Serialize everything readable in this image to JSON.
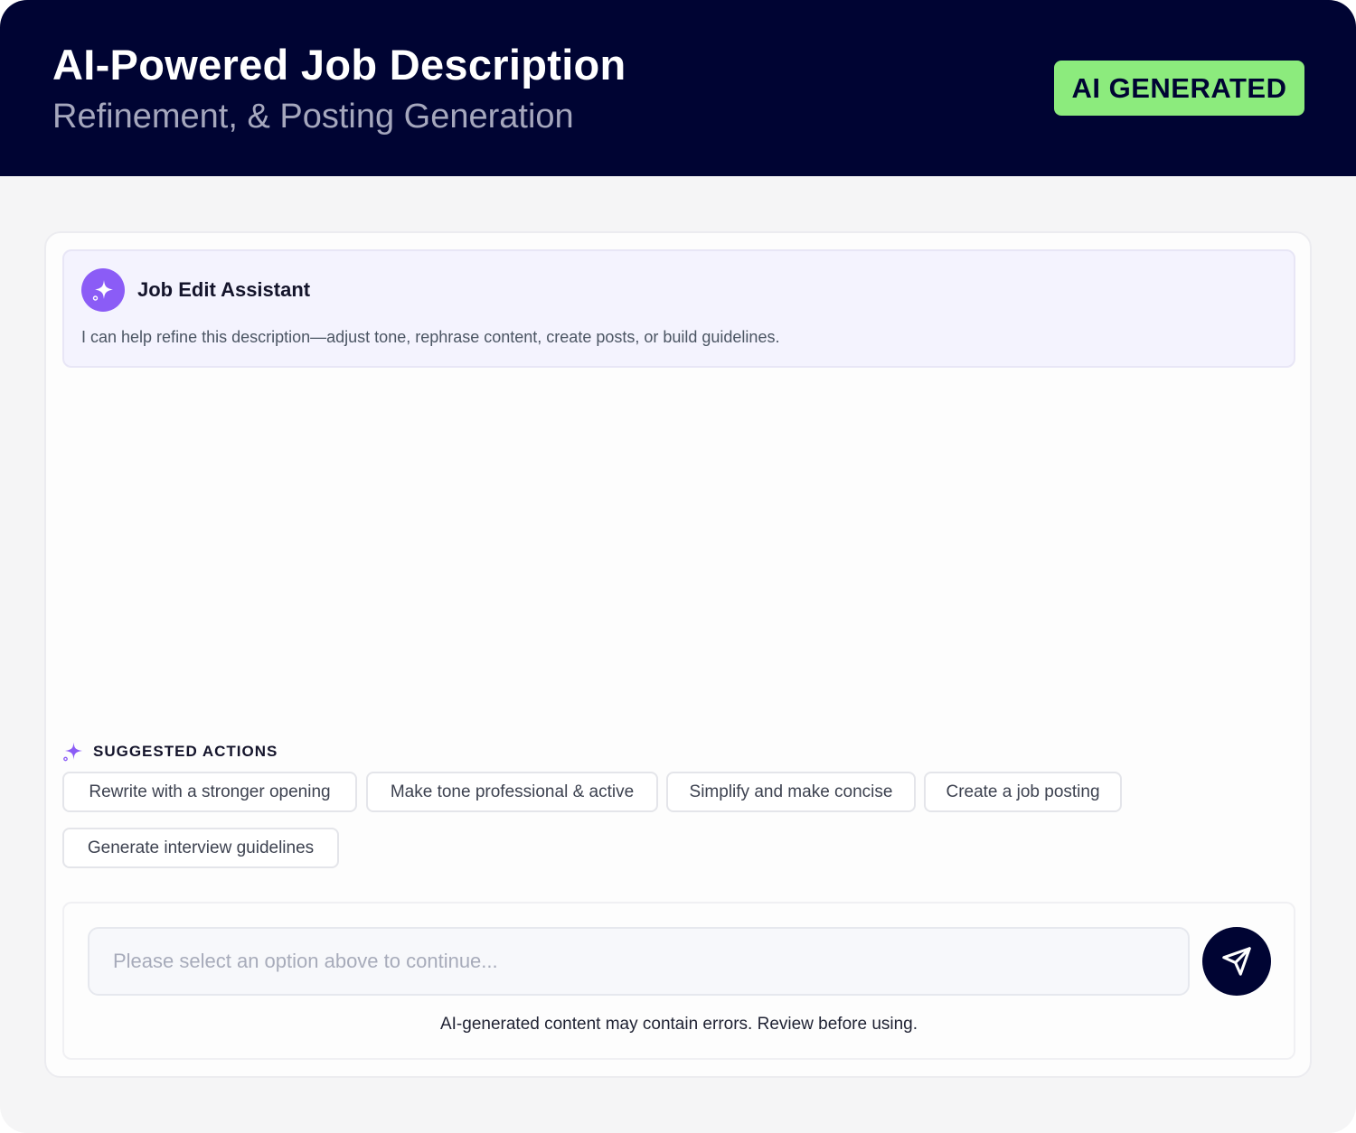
{
  "header": {
    "title": "AI-Powered Job Description",
    "subtitle": "Refinement, & Posting Generation",
    "badge": "AI GENERATED"
  },
  "assistant": {
    "title": "Job Edit Assistant",
    "description": "I can help refine this description—adjust tone, rephrase content, create posts, or build guidelines.",
    "icon": "sparkle-icon"
  },
  "suggestions": {
    "label": "SUGGESTED ACTIONS",
    "icon": "sparkle-icon",
    "items": [
      {
        "label": "Rewrite with a stronger opening"
      },
      {
        "label": "Make tone professional & active"
      },
      {
        "label": "Simplify and make concise"
      },
      {
        "label": "Create a job posting"
      },
      {
        "label": "Generate interview guidelines"
      }
    ]
  },
  "composer": {
    "placeholder": "Please select an option above to continue...",
    "value": "",
    "send_icon": "send-icon",
    "disclaimer": "AI-generated content may contain errors. Review before using."
  },
  "colors": {
    "header_bg": "#000433",
    "badge_bg": "#8CEB7D",
    "accent_purple": "#8B5CF6",
    "assistant_bg": "#F4F3FE",
    "page_bg": "#F5F5F6"
  }
}
